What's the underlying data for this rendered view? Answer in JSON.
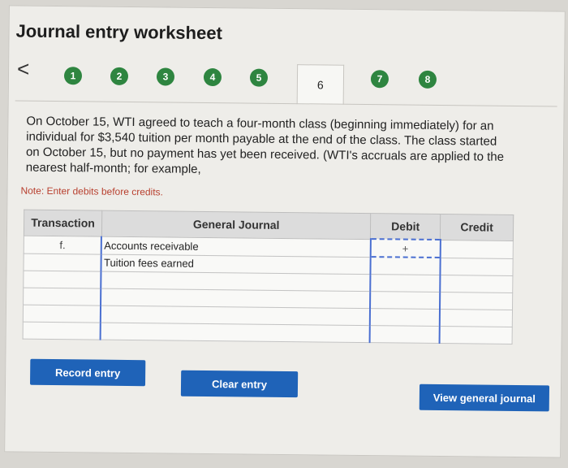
{
  "header": {
    "title": "Journal entry worksheet"
  },
  "nav": {
    "prev": "<",
    "steps": [
      "1",
      "2",
      "3",
      "4",
      "5",
      "6",
      "7",
      "8"
    ],
    "active_step": "6"
  },
  "prompt": {
    "text": "On October 15, WTI agreed to teach a four-month class (beginning immediately) for an individual for $3,540 tuition per month payable at the end of the class. The class started on October 15, but no payment has yet been received. (WTI's accruals are applied to the nearest half-month; for example,",
    "note": "Note: Enter debits before credits."
  },
  "table": {
    "headers": {
      "transaction": "Transaction",
      "journal": "General Journal",
      "debit": "Debit",
      "credit": "Credit"
    },
    "rows": [
      {
        "tx": "f.",
        "account": "Accounts receivable",
        "debit": "",
        "credit": ""
      },
      {
        "tx": "",
        "account": "Tuition fees earned",
        "debit": "",
        "credit": ""
      },
      {
        "tx": "",
        "account": "",
        "debit": "",
        "credit": ""
      },
      {
        "tx": "",
        "account": "",
        "debit": "",
        "credit": ""
      },
      {
        "tx": "",
        "account": "",
        "debit": "",
        "credit": ""
      },
      {
        "tx": "",
        "account": "",
        "debit": "",
        "credit": ""
      }
    ],
    "active_cell_icon": "+"
  },
  "buttons": {
    "record": "Record entry",
    "clear": "Clear entry",
    "view": "View general journal"
  },
  "colors": {
    "step_green": "#2e8540",
    "button_blue": "#1f63b8",
    "note_red": "#b8402f",
    "cell_border_blue": "#4a6fd1"
  }
}
